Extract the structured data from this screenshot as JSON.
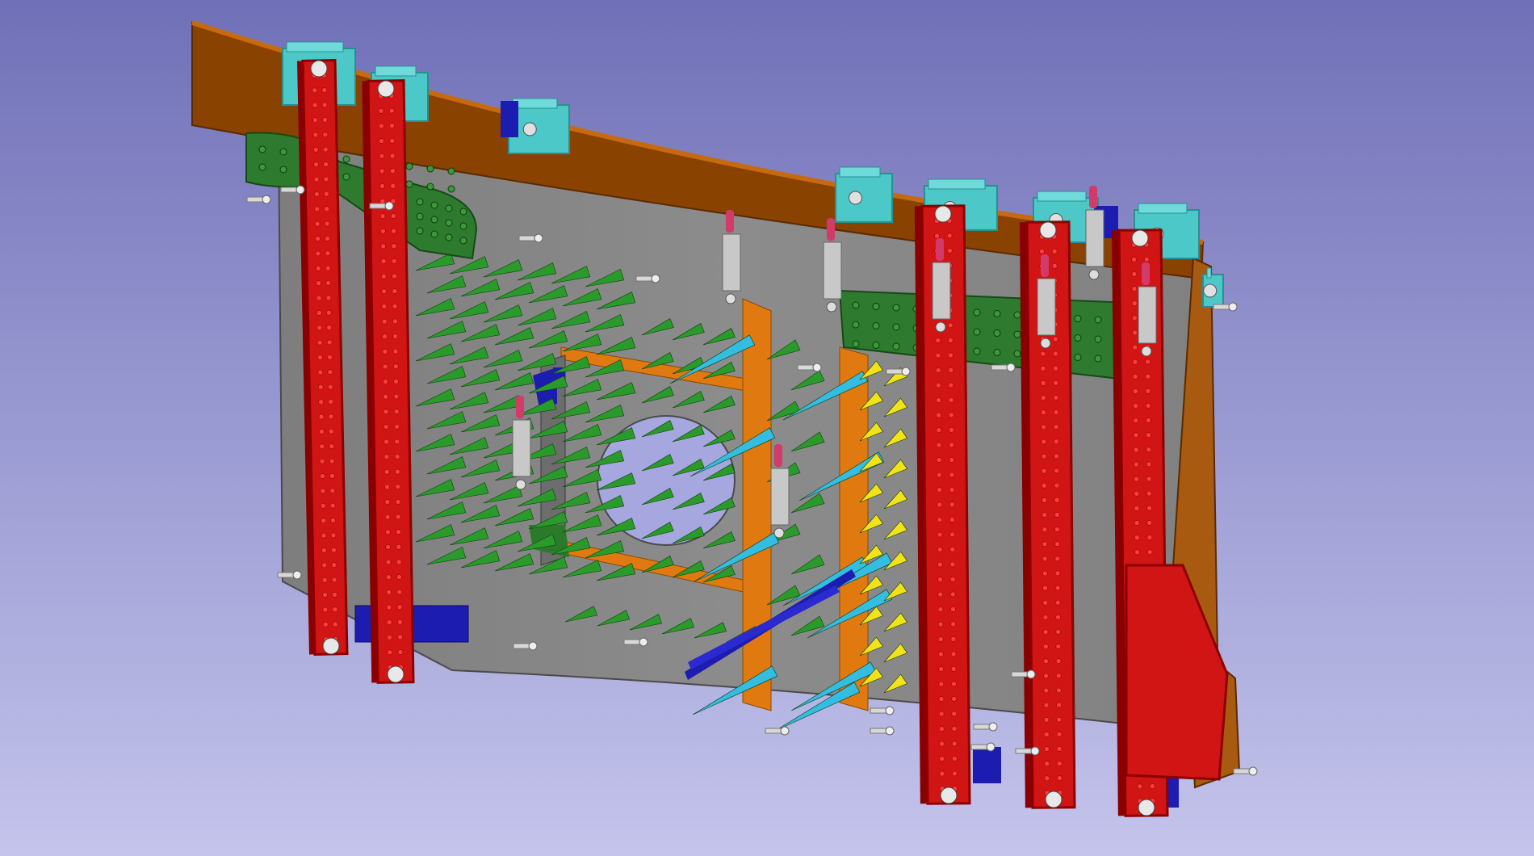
{
  "viewport": {
    "view_mode": "3d-cad-assembly",
    "background_top": "#7070b8",
    "background_bottom": "#c4c4ec"
  },
  "palette": {
    "panel": "#8a8a8a",
    "panel_dark": "#6a6a6a",
    "rail": "#8a4200",
    "rail_light": "#c66a12",
    "clamp_bar": "#d11414",
    "clamp_bar_dark": "#8a0000",
    "clamp_hole": "#ff3b3b",
    "holder_block": "#4cc8c8",
    "holder_block_dark": "#2a8f8f",
    "perforated_plate": "#2e7a2e",
    "locating_pin": "#2a9a2a",
    "long_pin": "#33bde0",
    "yellow_pin": "#f2e21a",
    "frame": "#e07a10",
    "bracket": "#1c1cb0",
    "toggle_clamp": "#c8c8c8",
    "handle": "#d23a6a"
  },
  "icons": {
    "toggle_clamp": "toggle-clamp-icon",
    "locating_pin": "locating-pin-icon",
    "fastener_bolt": "bolt-icon"
  }
}
